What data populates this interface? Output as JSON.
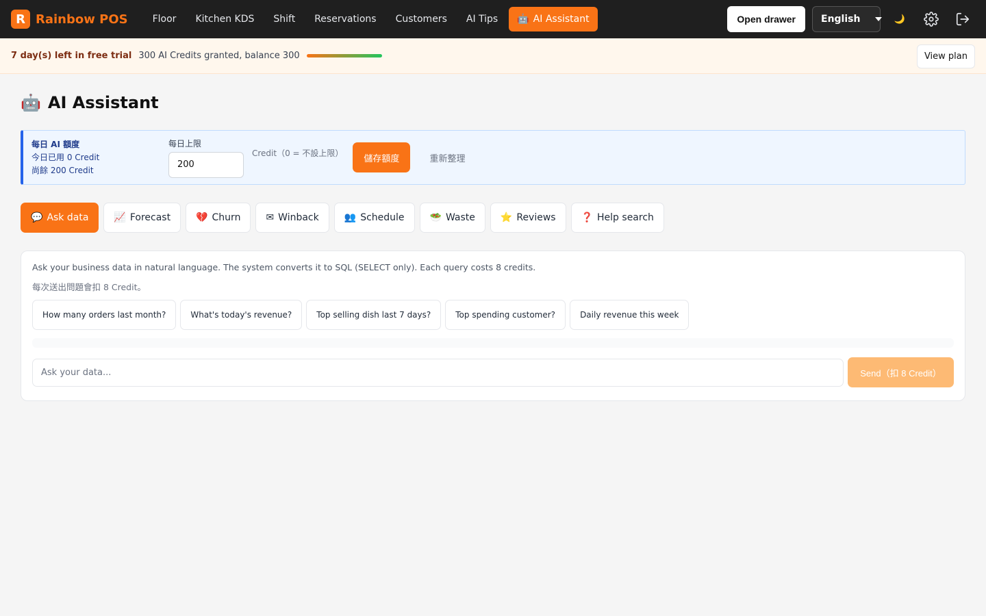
{
  "brand": {
    "logo_letter": "R",
    "name": "Rainbow POS"
  },
  "nav": {
    "items": [
      {
        "label": "Floor"
      },
      {
        "label": "Kitchen KDS"
      },
      {
        "label": "Shift"
      },
      {
        "label": "Reservations"
      },
      {
        "label": "Customers"
      },
      {
        "label": "AI Tips"
      },
      {
        "label": "AI Assistant",
        "active": true
      }
    ],
    "open_drawer": "Open drawer",
    "language": "English",
    "theme_icon": "🌙"
  },
  "trial": {
    "days_left": "7 day(s) left in free trial",
    "credits": "300 AI Credits granted, balance 300",
    "progress": 1.0,
    "view_plan": "View plan"
  },
  "page": {
    "title": "AI Assistant",
    "title_icon": "🤖"
  },
  "quota": {
    "title": "每日 AI 額度",
    "used": "今日已用 0 Credit",
    "remaining": "尚餘 200 Credit",
    "limit_label": "每日上限",
    "limit_value": "200",
    "hint": "Credit（0 = 不設上限）",
    "save": "儲存額度",
    "refresh": "重新整理"
  },
  "tabs": [
    {
      "icon": "💬",
      "label": "Ask data",
      "active": true
    },
    {
      "icon": "📈",
      "label": "Forecast"
    },
    {
      "icon": "💔",
      "label": "Churn"
    },
    {
      "icon": "✉",
      "label": "Winback"
    },
    {
      "icon": "👥",
      "label": "Schedule"
    },
    {
      "icon": "🥗",
      "label": "Waste"
    },
    {
      "icon": "⭐",
      "label": "Reviews"
    },
    {
      "icon": "❓",
      "label": "Help search"
    }
  ],
  "ask": {
    "description": "Ask your business data in natural language. The system converts it to SQL (SELECT only). Each query costs 8 credits.",
    "cost_note": "每次送出問題會扣 8 Credit。",
    "suggestions": [
      "How many orders last month?",
      "What's today's revenue?",
      "Top selling dish last 7 days?",
      "Top spending customer?",
      "Daily revenue this week"
    ],
    "placeholder": "Ask your data...",
    "send": "Send（扣 8 Credit）"
  }
}
